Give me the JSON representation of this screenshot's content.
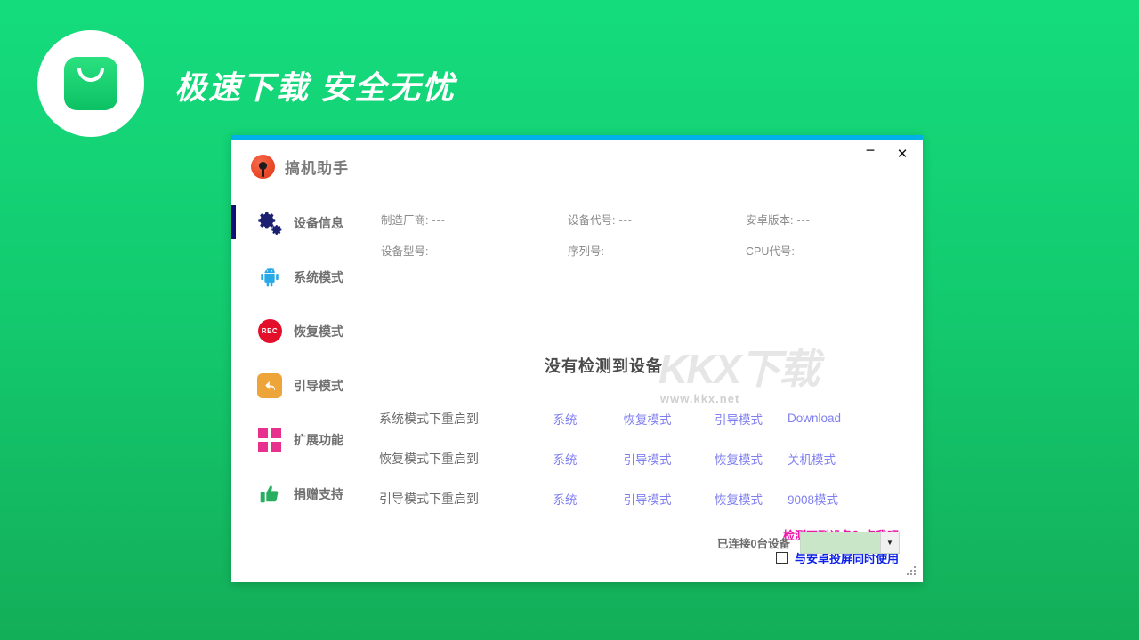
{
  "banner": {
    "title": "极速下载  安全无忧",
    "logo_icon": "shopping-bag-icon"
  },
  "window": {
    "app_title": "搞机助手",
    "app_icon": "app-logo-icon",
    "minimize_label": "−",
    "close_label": "✕"
  },
  "sidebar": {
    "items": [
      {
        "label": "设备信息",
        "icon": "gear-icon",
        "selected": true
      },
      {
        "label": "系统模式",
        "icon": "android-icon",
        "selected": false
      },
      {
        "label": "恢复模式",
        "icon": "rec-icon",
        "icon_text": "REC",
        "selected": false
      },
      {
        "label": "引导模式",
        "icon": "back-arrow-icon",
        "selected": false
      },
      {
        "label": "扩展功能",
        "icon": "grid-icon",
        "selected": false
      },
      {
        "label": "捐赠支持",
        "icon": "thumbs-up-icon",
        "selected": false
      }
    ]
  },
  "device_info": [
    {
      "key": "制造厂商:",
      "value": "---"
    },
    {
      "key": "设备代号:",
      "value": "---"
    },
    {
      "key": "安卓版本:",
      "value": "---"
    },
    {
      "key": "设备型号:",
      "value": "---"
    },
    {
      "key": "序列号:",
      "value": "---"
    },
    {
      "key": "CPU代号:",
      "value": "---"
    }
  ],
  "watermark": {
    "glyph": "KKX下载",
    "url": "www.kkx.net"
  },
  "status_message": "没有检测到设备",
  "reboot_rows": [
    {
      "label": "系统模式下重启到",
      "links": [
        "系统",
        "恢复模式",
        "引导模式",
        "Download"
      ]
    },
    {
      "label": "恢复模式下重启到",
      "links": [
        "系统",
        "引导模式",
        "恢复模式",
        "关机模式"
      ]
    },
    {
      "label": "引导模式下重启到",
      "links": [
        "系统",
        "引导模式",
        "恢复模式",
        "9008模式"
      ]
    }
  ],
  "help_link": "检测不到设备？点我吧",
  "checkbox": {
    "label": "与安卓投屏同时使用",
    "checked": false
  },
  "statusbar": {
    "connected_text": "已连接0台设备",
    "device_select_value": "",
    "dropdown_arrow": "▼"
  },
  "colors": {
    "background_top": "#14dc7d",
    "background_bottom": "#13ae58",
    "window_topbar": "#00b0e8",
    "link": "#7f7ff0",
    "help_link": "#ec17a9",
    "checkbox_label": "#0c22e8",
    "selected_indicator": "#0d1076"
  }
}
